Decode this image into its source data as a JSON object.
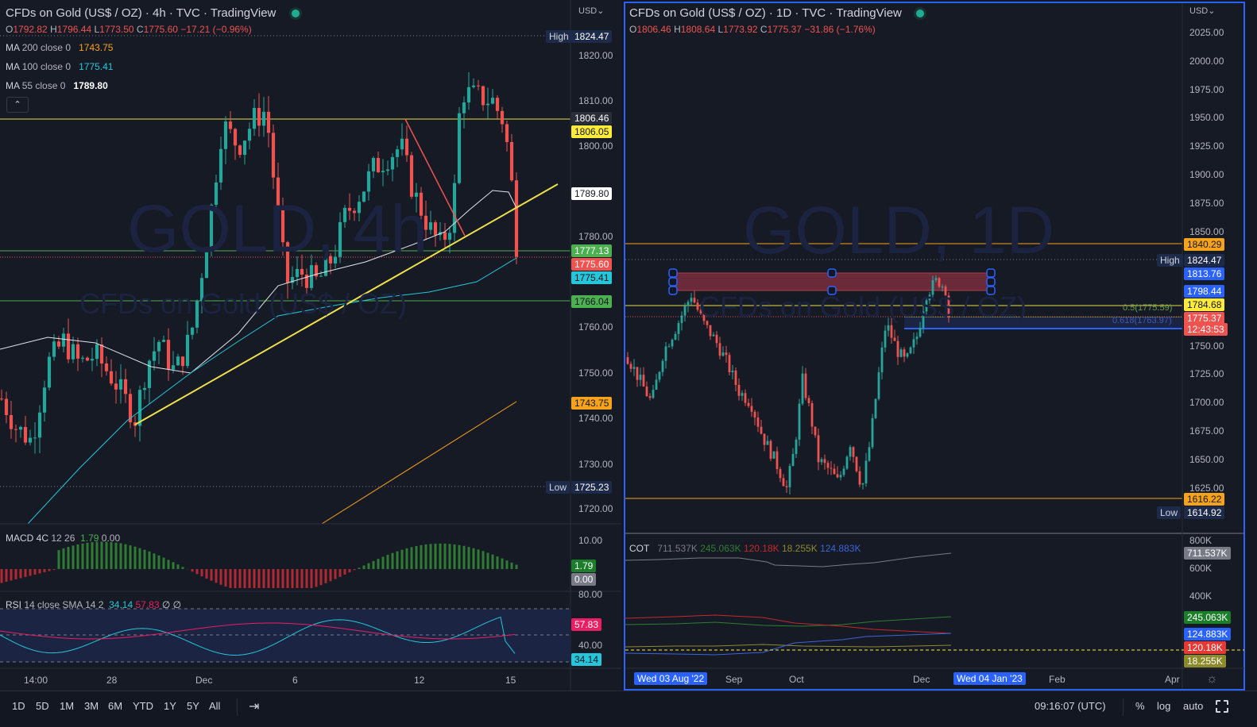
{
  "left": {
    "title": "CFDs on Gold (US$ / OZ) · 4h · TVC · TradingView",
    "ohlc": {
      "o_label": "O",
      "o": "1792.82",
      "h_label": "H",
      "h": "1796.44",
      "l_label": "L",
      "l": "1773.50",
      "c_label": "C",
      "c": "1775.60",
      "change": "−17.21 (−0.96%)"
    },
    "indicators": [
      {
        "name": "MA",
        "params": "200 close 0",
        "value": "1743.75",
        "color": "#f7a21b"
      },
      {
        "name": "MA",
        "params": "100 close 0",
        "value": "1775.41",
        "color": "#26c6da"
      },
      {
        "name": "MA",
        "params": "55 close 0",
        "value": "1789.80",
        "color": "#ffffff"
      }
    ],
    "currency": "USD",
    "watermark": "GOLD, 4h",
    "watermark_sub": "CFDs on Gold (US$ / OZ)",
    "axis_ticks": [
      "1820.00",
      "1810.00",
      "1800.00",
      "1780.00",
      "1760.00",
      "1750.00",
      "1740.00",
      "1730.00",
      "1720.00"
    ],
    "badges": {
      "high_label": "High",
      "high": "1824.47",
      "b1": "1806.46",
      "b2": "1806.05",
      "b3": "1789.80",
      "b4": "1777.13",
      "b5": "1775.60",
      "b6": "1775.41",
      "b7": "1766.04",
      "b8": "1743.75",
      "low_label": "Low",
      "low": "1725.23"
    },
    "price_path": [
      [
        0,
        1745
      ],
      [
        20,
        1738
      ],
      [
        40,
        1735
      ],
      [
        60,
        1752
      ],
      [
        80,
        1757
      ],
      [
        100,
        1752
      ],
      [
        120,
        1754
      ],
      [
        145,
        1748
      ],
      [
        170,
        1740
      ],
      [
        185,
        1752
      ],
      [
        200,
        1757
      ],
      [
        220,
        1750
      ],
      [
        240,
        1758
      ],
      [
        250,
        1768
      ],
      [
        265,
        1785
      ],
      [
        280,
        1805
      ],
      [
        300,
        1800
      ],
      [
        320,
        1806
      ],
      [
        335,
        1808
      ],
      [
        345,
        1792
      ],
      [
        360,
        1770
      ],
      [
        380,
        1772
      ],
      [
        400,
        1770
      ],
      [
        420,
        1776
      ],
      [
        435,
        1785
      ],
      [
        455,
        1790
      ],
      [
        470,
        1795
      ],
      [
        490,
        1798
      ],
      [
        505,
        1800
      ],
      [
        520,
        1790
      ],
      [
        540,
        1782
      ],
      [
        555,
        1778
      ],
      [
        570,
        1785
      ],
      [
        580,
        1812
      ],
      [
        600,
        1811
      ],
      [
        620,
        1810
      ],
      [
        635,
        1805
      ],
      [
        645,
        1790
      ],
      [
        651,
        1775.6
      ]
    ],
    "macd": {
      "label": "MACD 4C",
      "params": "12 26",
      "v1": "1.79",
      "v2": "0.00",
      "axis": "10.00",
      "badge1": "1.79",
      "badge2": "0.00"
    },
    "rsi": {
      "label": "RSI",
      "params": "14 close SMA 14 2",
      "v1": "34.14",
      "v2": "57.83",
      "v3": "∅ ∅",
      "axis1": "80.00",
      "axis2": "40.00",
      "badge1": "57.83",
      "badge2": "34.14"
    },
    "time_labels": [
      "14:00",
      "28",
      "Dec",
      "6",
      "12",
      "15"
    ]
  },
  "right": {
    "title": "CFDs on Gold (US$ / OZ) · 1D · TVC · TradingView",
    "ohlc": {
      "o_label": "O",
      "o": "1806.46",
      "h_label": "H",
      "h": "1808.64",
      "l_label": "L",
      "l": "1773.92",
      "c_label": "C",
      "c": "1775.37",
      "change": "−31.86 (−1.76%)"
    },
    "currency": "USD",
    "watermark": "GOLD, 1D",
    "watermark_sub": "CFDs on Gold (US$ / OZ)",
    "axis_ticks": [
      "2025.00",
      "2000.00",
      "1975.00",
      "1950.00",
      "1925.00",
      "1900.00",
      "1875.00",
      "1850.00",
      "1750.00",
      "1725.00",
      "1700.00",
      "1675.00",
      "1650.00",
      "1625.00"
    ],
    "badges": {
      "b1": "1840.29",
      "high_label": "High",
      "high": "1824.47",
      "b2": "1813.76",
      "b3": "1798.44",
      "b4": "1784.68",
      "b5": "1775.37",
      "countdown": "12:43:53",
      "b6": "1616.22",
      "low_label": "Low",
      "low": "1614.92"
    },
    "fib": {
      "f1": "0.5(1775.59)",
      "f2": "0.618(1763.97)"
    },
    "price_path": [
      [
        790,
        1740
      ],
      [
        805,
        1720
      ],
      [
        820,
        1700
      ],
      [
        835,
        1745
      ],
      [
        850,
        1765
      ],
      [
        870,
        1795
      ],
      [
        885,
        1770
      ],
      [
        900,
        1755
      ],
      [
        915,
        1735
      ],
      [
        930,
        1710
      ],
      [
        945,
        1700
      ],
      [
        960,
        1670
      ],
      [
        975,
        1650
      ],
      [
        990,
        1625
      ],
      [
        1000,
        1660
      ],
      [
        1010,
        1720
      ],
      [
        1020,
        1690
      ],
      [
        1030,
        1650
      ],
      [
        1045,
        1640
      ],
      [
        1055,
        1630
      ],
      [
        1070,
        1665
      ],
      [
        1085,
        1625
      ],
      [
        1095,
        1665
      ],
      [
        1105,
        1720
      ],
      [
        1115,
        1770
      ],
      [
        1130,
        1745
      ],
      [
        1140,
        1735
      ],
      [
        1155,
        1760
      ],
      [
        1165,
        1795
      ],
      [
        1180,
        1808
      ],
      [
        1190,
        1800
      ],
      [
        1197,
        1775
      ]
    ],
    "cot": {
      "label": "COT",
      "v1": "711.537K",
      "v2": "245.063K",
      "v3": "120.18K",
      "v4": "18.255K",
      "v5": "124.883K",
      "axis": [
        "800K",
        "600K",
        "400K"
      ],
      "badges": [
        "711.537K",
        "245.063K",
        "124.883K",
        "120.18K",
        "18.255K"
      ]
    },
    "time_labels": {
      "start": "Wed 03 Aug '22",
      "sep": "Sep",
      "oct": "Oct",
      "dec": "Dec",
      "cursor": "Wed 04 Jan '23",
      "feb": "Feb",
      "apr": "Apr"
    }
  },
  "toolbar": {
    "ranges": [
      "1D",
      "5D",
      "1M",
      "3M",
      "6M",
      "YTD",
      "1Y",
      "5Y",
      "All"
    ],
    "clock": "09:16:07 (UTC)",
    "pct": "%",
    "log": "log",
    "auto": "auto"
  },
  "colors": {
    "up": "#26a69a",
    "down": "#ef5350",
    "accent": "#2962ff"
  }
}
